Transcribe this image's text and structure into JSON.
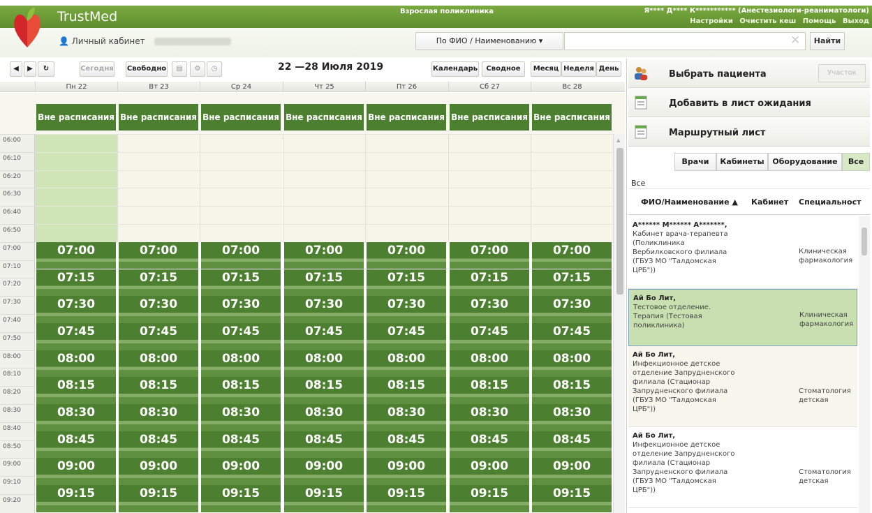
{
  "header": {
    "app_title": "TrustMed",
    "department": "Взрослая поликлиника",
    "user": "Я**** Д**** К*********** (Анестезиологи-реаниматологи)",
    "links": [
      "Настройки",
      "Очистить кеш",
      "Помощь",
      "Выход"
    ],
    "cabinet_label": "Личный кабинет",
    "search_type": "По ФИО / Наименованию",
    "search_value": "",
    "find_label": "Найти"
  },
  "toolbar": {
    "today": "Сегодня",
    "free": "Свободно",
    "week_title": "22 —28 Июля 2019",
    "calendar": "Календарь",
    "summary": "Сводное",
    "month": "Месяц",
    "week": "Неделя",
    "day": "День"
  },
  "calendar": {
    "days": [
      "Пн 22",
      "Вт 23",
      "Ср 24",
      "Чт 25",
      "Пт 26",
      "Сб 27",
      "Вс 28"
    ],
    "off_schedule": "Вне расписания",
    "time_labels": [
      "06:00",
      "06:10",
      "06:20",
      "06:30",
      "06:40",
      "06:50",
      "07:00",
      "07:10",
      "07:20",
      "07:30",
      "07:40",
      "07:50",
      "08:00",
      "08:10",
      "08:20",
      "08:30",
      "08:40",
      "08:50",
      "09:00",
      "09:10",
      "09:20"
    ],
    "slots": [
      "07:00",
      "07:15",
      "07:30",
      "07:45",
      "08:00",
      "08:15",
      "08:30",
      "08:45",
      "09:00",
      "09:15"
    ]
  },
  "right_panel": {
    "select_patient": "Выбрать пациента",
    "area": "Участок",
    "add_waitlist": "Добавить в лист ожидания",
    "route_sheet": "Маршрутный лист",
    "tabs": [
      "Врачи",
      "Кабинеты",
      "Оборудование",
      "Все"
    ],
    "filter": "Все",
    "columns": [
      "ФИО/Наименование",
      "Кабинет",
      "Специальност"
    ],
    "rows": [
      {
        "name": "А****** М****** А*******,",
        "details": [
          "Кабинет врача-терапевта",
          "(Поликлиника",
          "Вербилковского филиала",
          "(ГБУЗ МО \"Талдомская",
          "ЦРБ\"))"
        ],
        "spec": [
          "Клиническая",
          "фармакология"
        ]
      },
      {
        "name": "Ай Бо Лит,",
        "details": [
          "Тестовое отделение.",
          "Терапия (Тестовая",
          "поликлиника)"
        ],
        "spec": [
          "Клиническая",
          "фармакология"
        ]
      },
      {
        "name": "Ай Бо Лит,",
        "details": [
          "Инфекционное детское",
          "отделение Запрудненского",
          "филиала (Стационар",
          "Запрудненского филиала",
          "(ГБУЗ МО \"Талдомская",
          "ЦРБ\"))"
        ],
        "spec": [
          "Стоматология",
          "детская"
        ]
      },
      {
        "name": "Ай Бо Лит,",
        "details": [
          "Инфекционное детское",
          "отделение Запрудненского",
          "филиала (Стационар",
          "Запрудненского филиала",
          "(ГБУЗ МО \"Талдомская",
          "ЦРБ\"))"
        ],
        "spec": [
          "Стоматология",
          "детская"
        ]
      }
    ]
  }
}
